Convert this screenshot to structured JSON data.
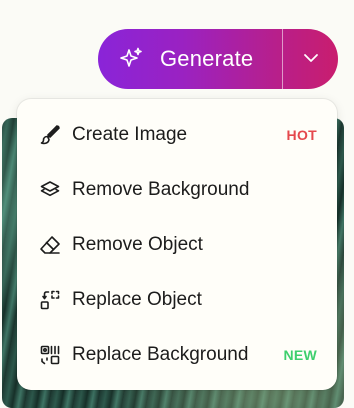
{
  "generate": {
    "label": "Generate",
    "icon": "sparkles-icon",
    "toggle_icon": "chevron-down-icon",
    "gradient": [
      "#8a24d8",
      "#c91d6e"
    ]
  },
  "menu": {
    "items": [
      {
        "label": "Create Image",
        "icon": "brush-icon",
        "badge": "HOT",
        "badge_color": "#e5484d"
      },
      {
        "label": "Remove Background",
        "icon": "layers-icon",
        "badge": "",
        "badge_color": ""
      },
      {
        "label": "Remove Object",
        "icon": "eraser-icon",
        "badge": "",
        "badge_color": ""
      },
      {
        "label": "Replace Object",
        "icon": "replace-object-icon",
        "badge": "",
        "badge_color": ""
      },
      {
        "label": "Replace Background",
        "icon": "replace-background-icon",
        "badge": "NEW",
        "badge_color": "#3ecf6e"
      }
    ]
  }
}
